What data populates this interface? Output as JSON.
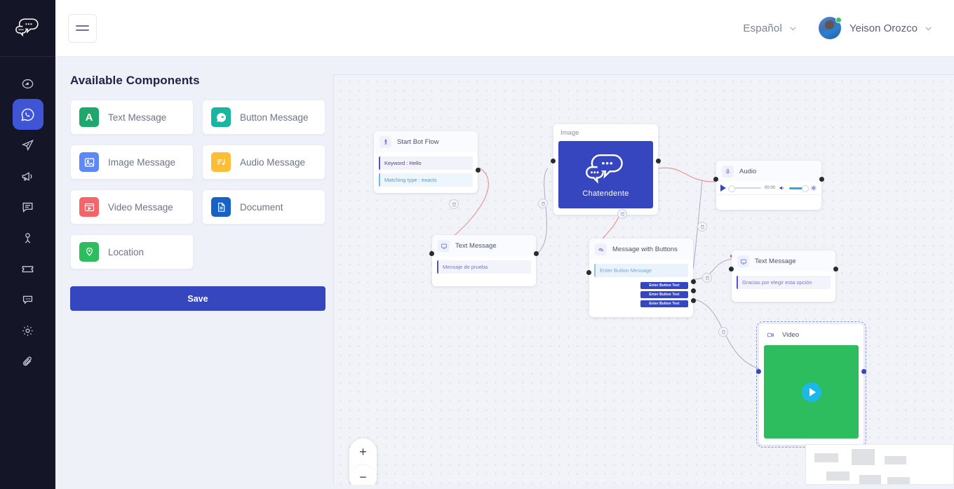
{
  "app": {
    "logo_icon": "chat-bubbles-logo",
    "brand": "Chatendente"
  },
  "sidebar": {
    "items": [
      {
        "icon": "dashboard-icon",
        "name": "dashboard",
        "active": false
      },
      {
        "icon": "whatsapp-icon",
        "name": "whatsapp",
        "active": true
      },
      {
        "icon": "send-icon",
        "name": "campaigns-send",
        "active": false
      },
      {
        "icon": "megaphone-icon",
        "name": "announcements",
        "active": false
      },
      {
        "icon": "comment-icon",
        "name": "chats",
        "active": false
      },
      {
        "icon": "user-icon",
        "name": "contacts",
        "active": false
      },
      {
        "icon": "ticket-icon",
        "name": "tickets",
        "active": false
      },
      {
        "icon": "chat-dots-icon",
        "name": "messages",
        "active": false
      },
      {
        "icon": "gear-icon",
        "name": "settings",
        "active": false
      },
      {
        "icon": "paperclip-icon",
        "name": "attachments",
        "active": false
      }
    ]
  },
  "header": {
    "menu_icon": "hamburger-icon",
    "language": "Español",
    "language_chevron": "chevron-down-icon",
    "user_name": "Yeison Orozco",
    "user_chevron": "chevron-down-icon",
    "status": "online"
  },
  "panel": {
    "title": "Available Components",
    "components": [
      {
        "label": "Text Message",
        "icon": "text-message-icon",
        "color": "#1fa86b",
        "glyph": "A"
      },
      {
        "label": "Button Message",
        "icon": "button-message-icon",
        "color": "#18b5a0"
      },
      {
        "label": "Image Message",
        "icon": "image-message-icon",
        "color": "#5d88f5"
      },
      {
        "label": "Audio Message",
        "icon": "audio-message-icon",
        "color": "#fbbe36"
      },
      {
        "label": "Video Message",
        "icon": "video-message-icon",
        "color": "#f4656a"
      },
      {
        "label": "Document",
        "icon": "document-icon",
        "color": "#1862c6"
      },
      {
        "label": "Location",
        "icon": "location-icon",
        "color": "#2dbd5f"
      }
    ],
    "save_label": "Save",
    "save_color": "#3546bf"
  },
  "canvas": {
    "zoom_in_label": "+",
    "zoom_out_label": "−",
    "nodes": {
      "start": {
        "title": "Start Bot Flow",
        "icon": "flow-start-icon",
        "keyword": "Keyword : Hello",
        "matching": "Matching type : exacts"
      },
      "text1": {
        "title": "Text Message",
        "icon": "text-node-icon",
        "message": "Mensaje de prueba"
      },
      "image": {
        "title": "Image",
        "icon": "image-node-icon",
        "preview_caption": "Chatendente",
        "preview_color": "#3546bf"
      },
      "audio": {
        "title": "Audio",
        "icon": "audio-node-icon",
        "time": "00:00",
        "play_icon": "play-icon",
        "volume_icon": "volume-icon",
        "settings_icon": "gear-icon"
      },
      "buttons": {
        "title": "Message with Buttons",
        "icon": "reply-icon",
        "message_placeholder": "Enter Button Message",
        "buttons": [
          "Enter Button Text",
          "Enter Button Text",
          "Enter Button Text"
        ]
      },
      "text2": {
        "title": "Text Message",
        "icon": "text-node-icon",
        "message": "Gracias por elegir esta opción"
      },
      "video": {
        "title": "Video",
        "icon": "video-node-icon",
        "preview_color": "#2dbd5f",
        "play_icon": "play-icon",
        "selected": true
      }
    },
    "edge_delete_icon": "trash-icon"
  }
}
